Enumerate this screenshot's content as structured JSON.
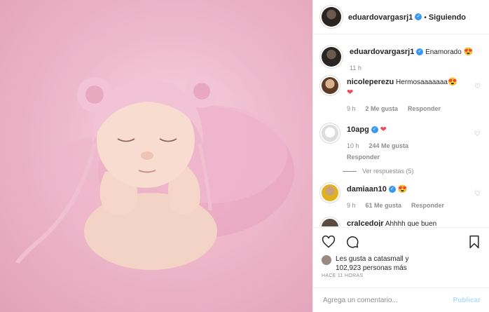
{
  "header": {
    "username": "eduardovargasrj1",
    "separator": "•",
    "follow_status": "Siguiendo"
  },
  "caption": {
    "username": "eduardovargasrj1",
    "text": "Enamorado",
    "emoji": "😍",
    "time": "11 h"
  },
  "comments": [
    {
      "username": "nicoleperezu",
      "text": "Hermosaaaaaaa",
      "emoji": "😍",
      "extra": "❤",
      "time": "9 h",
      "likes": "2 Me gusta",
      "reply": "Responder"
    },
    {
      "username": "10apg",
      "text": "",
      "emoji": "",
      "extra": "❤",
      "time": "10 h",
      "likes": "244 Me gusta",
      "reply": "Responder",
      "view_replies": "Ver respuestas (5)"
    },
    {
      "username": "damiaan10",
      "text": "",
      "emoji": "😍",
      "extra": "",
      "time": "9 h",
      "likes": "61 Me gusta",
      "reply": "Responder"
    },
    {
      "username": "cralcedojr",
      "text": "Ahhhh que buen",
      "emoji": "",
      "extra": "",
      "time": "",
      "likes": "",
      "reply": ""
    }
  ],
  "likes": {
    "line1": "Les gusta a catasmall y",
    "line2": "102,923 personas más"
  },
  "post_time": "HACE 11 HORAS",
  "add_comment": {
    "placeholder": "Agrega un comentario...",
    "publish": "Publicar"
  },
  "colors": {
    "verified": "#3897f0",
    "link": "#b2dffc",
    "photo_bg": "#eeb8cb"
  }
}
